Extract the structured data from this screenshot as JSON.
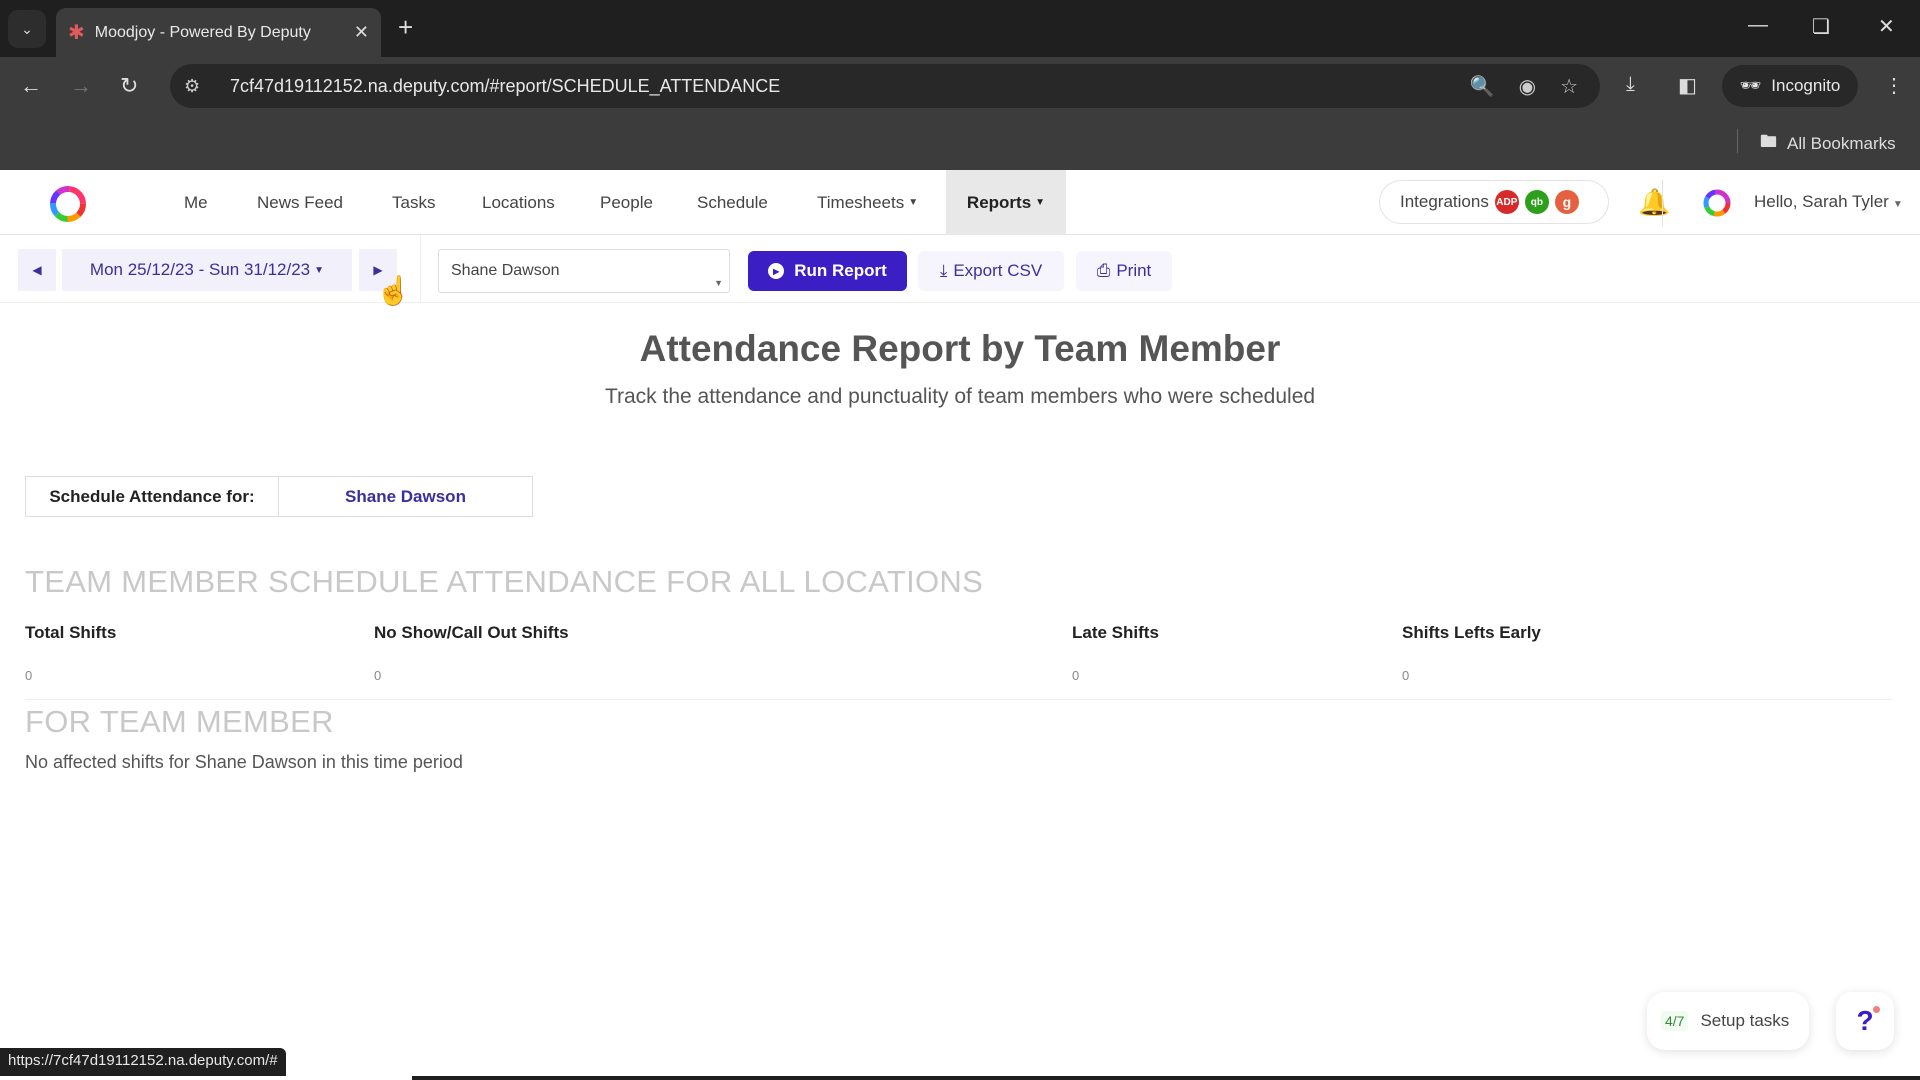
{
  "browser": {
    "tab_title": "Moodjoy - Powered By Deputy",
    "url": "7cf47d19112152.na.deputy.com/#report/SCHEDULE_ATTENDANCE",
    "incognito_label": "Incognito",
    "bookmarks_label": "All Bookmarks",
    "status_url": "https://7cf47d19112152.na.deputy.com/#"
  },
  "nav": {
    "items": [
      {
        "label": "Me"
      },
      {
        "label": "News Feed"
      },
      {
        "label": "Tasks"
      },
      {
        "label": "Locations"
      },
      {
        "label": "People"
      },
      {
        "label": "Schedule"
      },
      {
        "label": "Timesheets"
      },
      {
        "label": "Reports"
      }
    ],
    "integrations_label": "Integrations",
    "integration_badges": [
      {
        "label": "ADP",
        "color": "#d62b2b"
      },
      {
        "label": "qb",
        "color": "#2ca01c"
      },
      {
        "label": "g",
        "color": "#e5603f"
      }
    ],
    "greeting": "Hello, Sarah Tyler"
  },
  "filters": {
    "date_range": "Mon 25/12/23 - Sun 31/12/23",
    "employee_select": "Shane Dawson",
    "run_report": "Run Report",
    "export_csv": "Export CSV",
    "print": "Print"
  },
  "report": {
    "title": "Attendance Report by Team Member",
    "subtitle": "Track the attendance and punctuality of team members who were scheduled",
    "for_label": "Schedule Attendance for:",
    "for_value": "Shane Dawson",
    "section_all_locations": "TEAM MEMBER SCHEDULE ATTENDANCE FOR ALL LOCATIONS",
    "stats": [
      {
        "label": "Total Shifts",
        "value": "0"
      },
      {
        "label": "No Show/Call Out Shifts",
        "value": "0"
      },
      {
        "label": "Late Shifts",
        "value": "0"
      },
      {
        "label": "Shifts Lefts Early",
        "value": "0"
      }
    ],
    "section_team_member": "FOR TEAM MEMBER",
    "empty_message": "No affected shifts for Shane Dawson in this time period"
  },
  "widgets": {
    "setup_count": "4/7",
    "setup_label": "Setup tasks",
    "help_label": "?"
  },
  "colors": {
    "brand_primary": "#3b1fc5",
    "brand_text": "#3b2f9e"
  }
}
